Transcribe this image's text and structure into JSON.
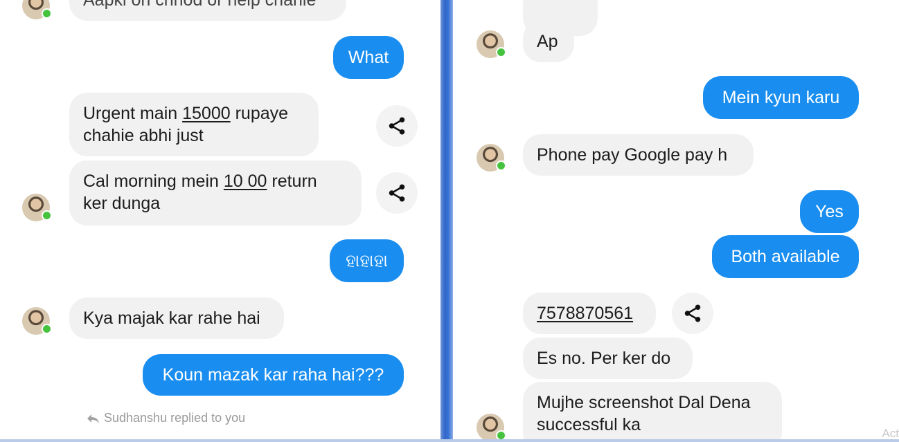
{
  "left_panel": {
    "partial_top_message": "Aapki on chhod or help chahie",
    "messages": {
      "what": "What",
      "urgent_line1": "Urgent main ",
      "urgent_amount": "15000",
      "urgent_line1_end": " rupaye",
      "urgent_line2": "chahie abhi just",
      "cal_line1": "Cal morning mein ",
      "cal_amount": "10 00",
      "cal_line1_end": " return",
      "cal_line2": "ker dunga",
      "hahaha": "ହାହାହା",
      "kya_majak": "Kya majak kar rahe hai",
      "koun_mazak": "Koun mazak kar raha hai???"
    },
    "reply_note": "Sudhanshu replied to you"
  },
  "right_panel": {
    "messages": {
      "ap": "Ap",
      "mein_kyun": "Mein kyun karu",
      "phone_pay": "Phone pay Google pay h",
      "yes": "Yes",
      "both_available": "Both available",
      "phone_number": "7578870561",
      "es_no": "Es no. Per ker do",
      "mujhe_line1": "Mujhe screenshot Dal Dena",
      "mujhe_line2": "successful ka"
    }
  },
  "watermark": "Act",
  "colors": {
    "outgoing_bubble": "#1a8ef0",
    "incoming_bubble": "#f1f1f1",
    "online_dot": "#45c33f",
    "divider": "#2f66c8"
  },
  "icons": {
    "share": "share-icon",
    "reply": "reply-arrow-icon",
    "online": "online-dot-icon"
  }
}
